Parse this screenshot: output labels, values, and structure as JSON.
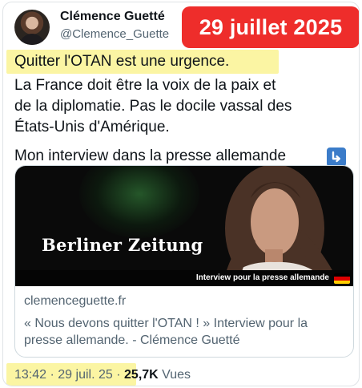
{
  "author": {
    "name": "Clémence Guetté",
    "handle": "@Clemence_Guette"
  },
  "date_badge": "29 juillet 2025",
  "tweet": {
    "lines": [
      "Quitter l'OTAN est une urgence.",
      "La France doit être la voix de la paix et",
      "de la diplomatie. Pas le docile vassal des",
      "États-Unis d'Amérique.",
      "Mon interview dans la presse allemande"
    ],
    "arrow_icon": "arrow-down-right-icon"
  },
  "link_card": {
    "image": {
      "logo_text": "Berliner Zeitung",
      "caption": "Interview pour la presse allemande",
      "flag_colors": [
        "#000000",
        "#dd0000",
        "#ffce00"
      ]
    },
    "domain": "clemenceguette.fr",
    "title_lines": [
      "« Nous devons quitter l'OTAN ! » Interview pour la",
      "presse allemande. - Clémence Guetté"
    ]
  },
  "meta": {
    "time": "13:42",
    "date": "29 juil. 25",
    "views_count": "25,7K",
    "views_label": "Vues"
  },
  "colors": {
    "badge": "#ee2d2b",
    "highlight": "#fbf5a3",
    "secondary_text": "#536471"
  }
}
